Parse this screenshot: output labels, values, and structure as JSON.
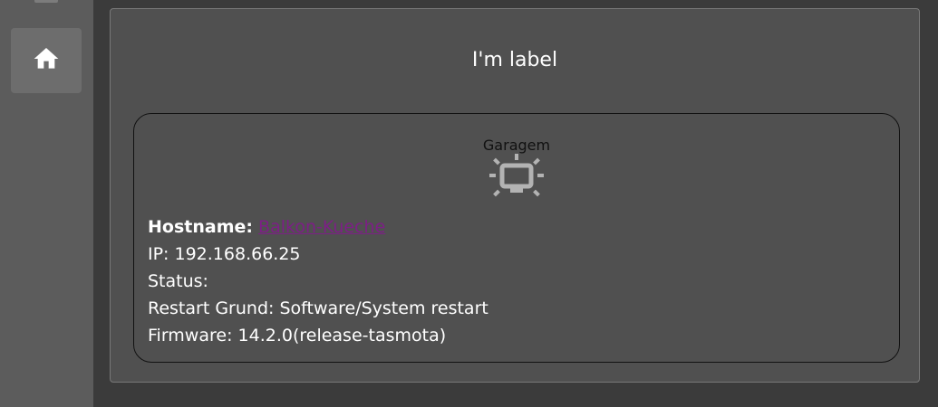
{
  "sidebar": {
    "home_icon": "home-icon"
  },
  "card": {
    "title": "I'm label"
  },
  "device": {
    "name": "Garagem",
    "icon": "monitor-light-icon",
    "hostname_label": "Hostname:",
    "hostname_value": "Balkon-Kueche",
    "ip_line": "IP: 192.168.66.25",
    "status_line": "Status:",
    "restart_line": "Restart Grund: Software/System restart",
    "firmware_line": "Firmware: 14.2.0(release-tasmota)",
    "link_color": "#7d1f86"
  }
}
